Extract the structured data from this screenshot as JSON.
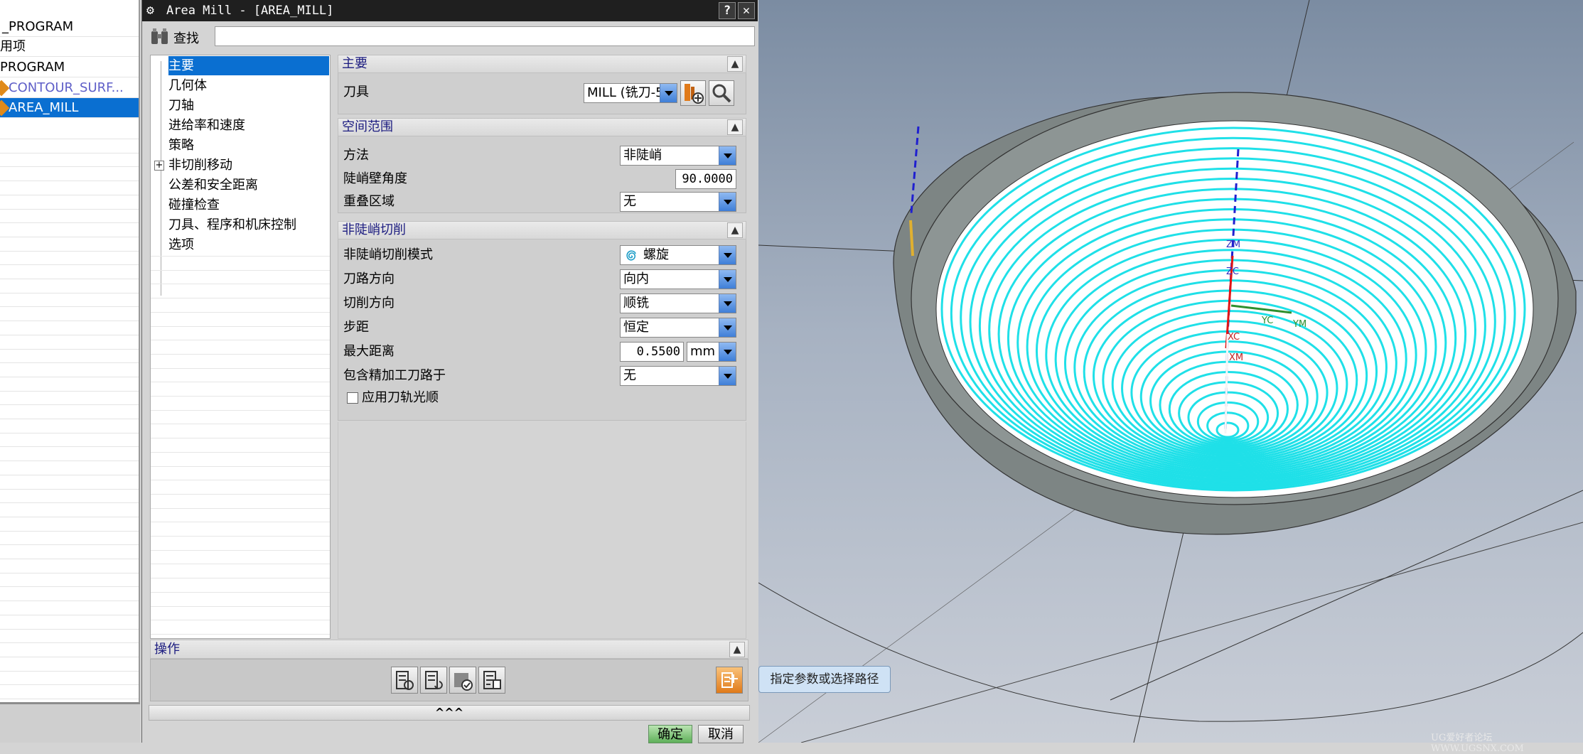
{
  "nav_tree": {
    "items": [
      {
        "label": "_PROGRAM"
      },
      {
        "label": "用项"
      },
      {
        "label": "PROGRAM"
      },
      {
        "label": "CONTOUR_SURF..."
      },
      {
        "label": "AREA_MILL"
      }
    ]
  },
  "dialog": {
    "title": "Area Mill - [AREA_MILL]",
    "help_label": "?",
    "close_label": "✕",
    "find_label": "查找",
    "find_value": "",
    "tree": [
      {
        "label": "主要"
      },
      {
        "label": "几何体"
      },
      {
        "label": "刀轴"
      },
      {
        "label": "进给率和速度"
      },
      {
        "label": "策略"
      },
      {
        "label": "非切削移动"
      },
      {
        "label": "公差和安全距离"
      },
      {
        "label": "碰撞检查"
      },
      {
        "label": "刀具、程序和机床控制"
      },
      {
        "label": "选项"
      }
    ],
    "expand_label": "+",
    "main_section": {
      "title": "主要",
      "tool_label": "刀具",
      "tool_value": "MILL (铣刀-5"
    },
    "space_section": {
      "title": "空间范围",
      "method_label": "方法",
      "method_value": "非陡峭",
      "steep_angle_label": "陡峭壁角度",
      "steep_angle_value": "90.0000",
      "overlap_label": "重叠区域",
      "overlap_value": "无"
    },
    "nonsteep_section": {
      "title": "非陡峭切削",
      "mode_label": "非陡峭切削模式",
      "mode_value": "螺旋",
      "path_dir_label": "刀路方向",
      "path_dir_value": "向内",
      "cut_dir_label": "切削方向",
      "cut_dir_value": "顺铣",
      "stepover_label": "步距",
      "stepover_value": "恒定",
      "max_dist_label": "最大距离",
      "max_dist_value": "0.5500",
      "max_dist_unit": "mm",
      "finish_label": "包含精加工刀路于",
      "finish_value": "无",
      "smooth_label": "应用刀轨光顺",
      "smooth_checked": false
    },
    "operations": {
      "title": "操作"
    },
    "more_label": "^^^",
    "ok_label": "确定",
    "cancel_label": "取消"
  },
  "viewport": {
    "hint": "指定参数或选择路径",
    "watermark": "UG爱好者论坛 WWW.UGSNX.COM",
    "axis_labels": [
      "ZM",
      "ZC",
      "YC",
      "YM",
      "XC",
      "XM"
    ],
    "path_color": "#1fe0e8"
  },
  "colors": {
    "selection": "#0a6fd1",
    "section_title": "#1c1c80"
  }
}
